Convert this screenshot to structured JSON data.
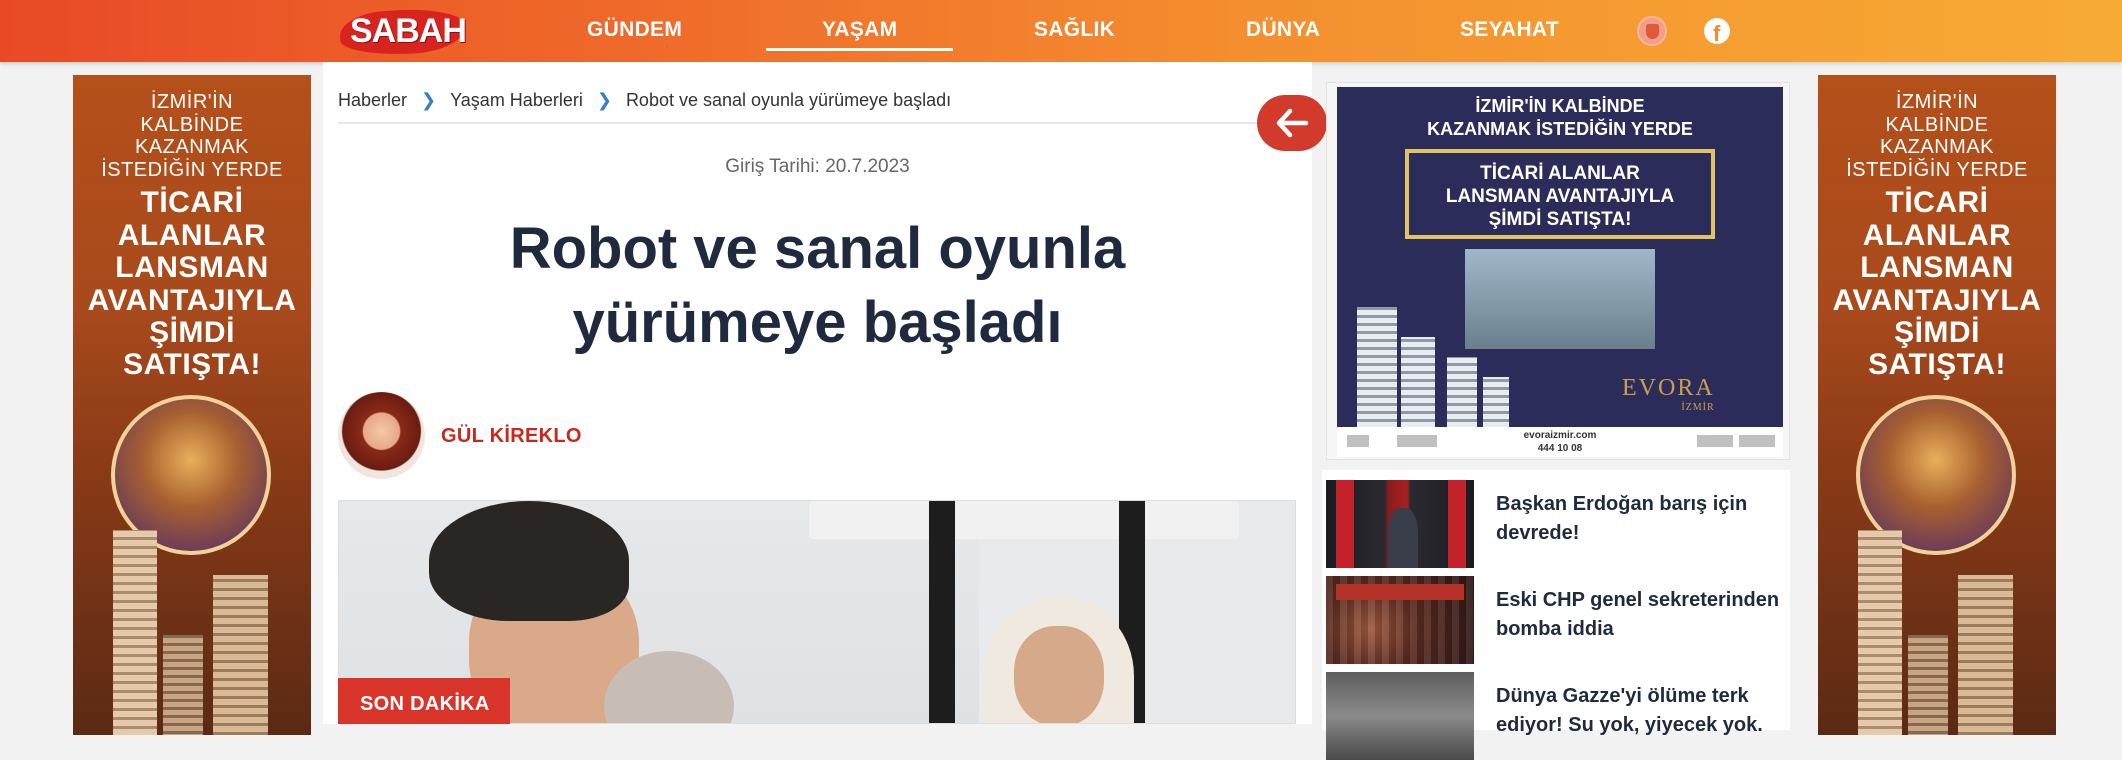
{
  "header": {
    "logo": "SABAH",
    "nav": [
      "GÜNDEM",
      "YAŞAM",
      "SAĞLIK",
      "DÜNYA",
      "SEYAHAT"
    ],
    "active_nav": "YAŞAM",
    "icons": [
      "badge-icon",
      "facebook-icon"
    ],
    "facebook_glyph": "f"
  },
  "breadcrumb": [
    "Haberler",
    "Yaşam Haberleri",
    "Robot ve sanal oyunla yürümeye başladı"
  ],
  "article": {
    "date": "Giriş Tarihi: 20.7.2023",
    "title": "Robot ve sanal oyunla yürümeye başladı",
    "author": "GÜL KİREKLO",
    "badge": "SON DAKİKA"
  },
  "side_ad": {
    "lines_small": [
      "İZMİR'İN",
      "KALBİNDE",
      "KAZANMAK",
      "İSTEDİĞİN YERDE"
    ],
    "lines_big": [
      "TİCARİ",
      "ALANLAR",
      "LANSMAN",
      "AVANTAJIYLA",
      "ŞİMDİ",
      "SATIŞTA!"
    ]
  },
  "right_ad": {
    "line1": "İZMİR'İN KALBİNDE",
    "line2": "KAZANMAK İSTEDİĞİN YERDE",
    "box": [
      "TİCARİ ALANLAR",
      "LANSMAN AVANTAJIYLA",
      "ŞİMDİ SATIŞTA!"
    ],
    "brand": "EVORA",
    "brand_sub": "İZMİR",
    "site": "evoraizmir.com",
    "phone": "444 10 08"
  },
  "news": [
    {
      "title": "Başkan Erdoğan barış için devrede!"
    },
    {
      "title": "Eski CHP genel sekreterinden bomba iddia"
    },
    {
      "title": "Dünya Gazze'yi ölüme terk ediyor! Su yok, yiyecek yok."
    }
  ],
  "colors": {
    "header_start": "#e84a26",
    "header_end": "#f7ab34",
    "accent_red": "#d23a2c",
    "title_navy": "#1f2a3e",
    "author_red": "#c8281e",
    "link_blue": "#3a7cc4"
  }
}
